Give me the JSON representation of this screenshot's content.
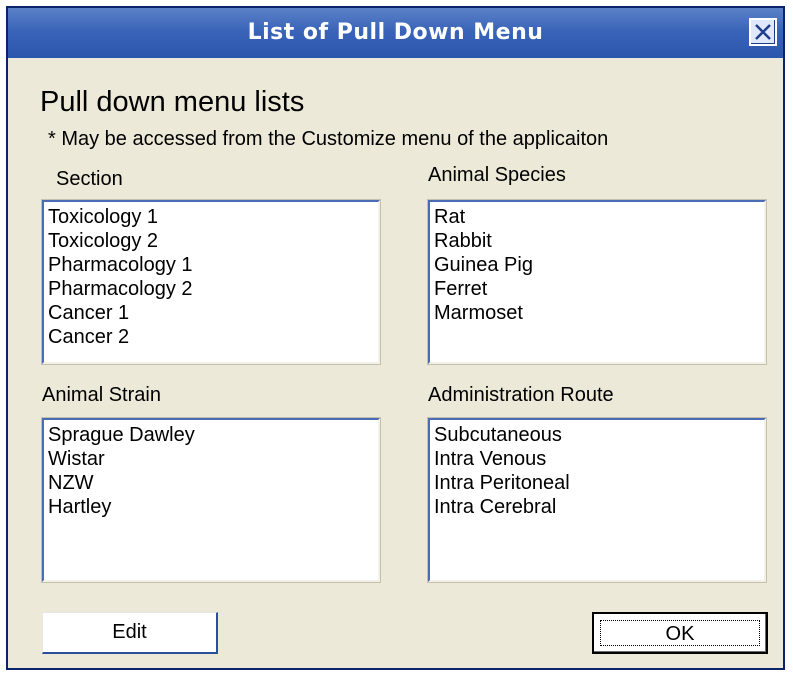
{
  "dialog": {
    "title": "List of Pull Down Menu",
    "close_icon": "close-icon"
  },
  "header": {
    "heading": "Pull down menu lists",
    "note": "* May be accessed from the Customize menu of the applicaiton"
  },
  "section": {
    "label": "Section",
    "items": [
      "Toxicology 1",
      "Toxicology 2",
      "Pharmacology 1",
      "Pharmacology 2",
      "Cancer 1",
      "Cancer 2"
    ]
  },
  "animal_species": {
    "label": "Animal Species",
    "items": [
      "Rat",
      "Rabbit",
      "Guinea Pig",
      "Ferret",
      "Marmoset"
    ]
  },
  "animal_strain": {
    "label": "Animal Strain",
    "items": [
      "Sprague Dawley",
      "Wistar",
      "NZW",
      "Hartley"
    ]
  },
  "administration_route": {
    "label": "Administration Route",
    "items": [
      "Subcutaneous",
      "Intra Venous",
      "Intra Peritoneal",
      "Intra Cerebral"
    ]
  },
  "buttons": {
    "edit": "Edit",
    "ok": "OK"
  },
  "colors": {
    "titlebar": "#3a64b8",
    "dialog_bg": "#ece9d8",
    "list_border": "#4a6cb4"
  }
}
